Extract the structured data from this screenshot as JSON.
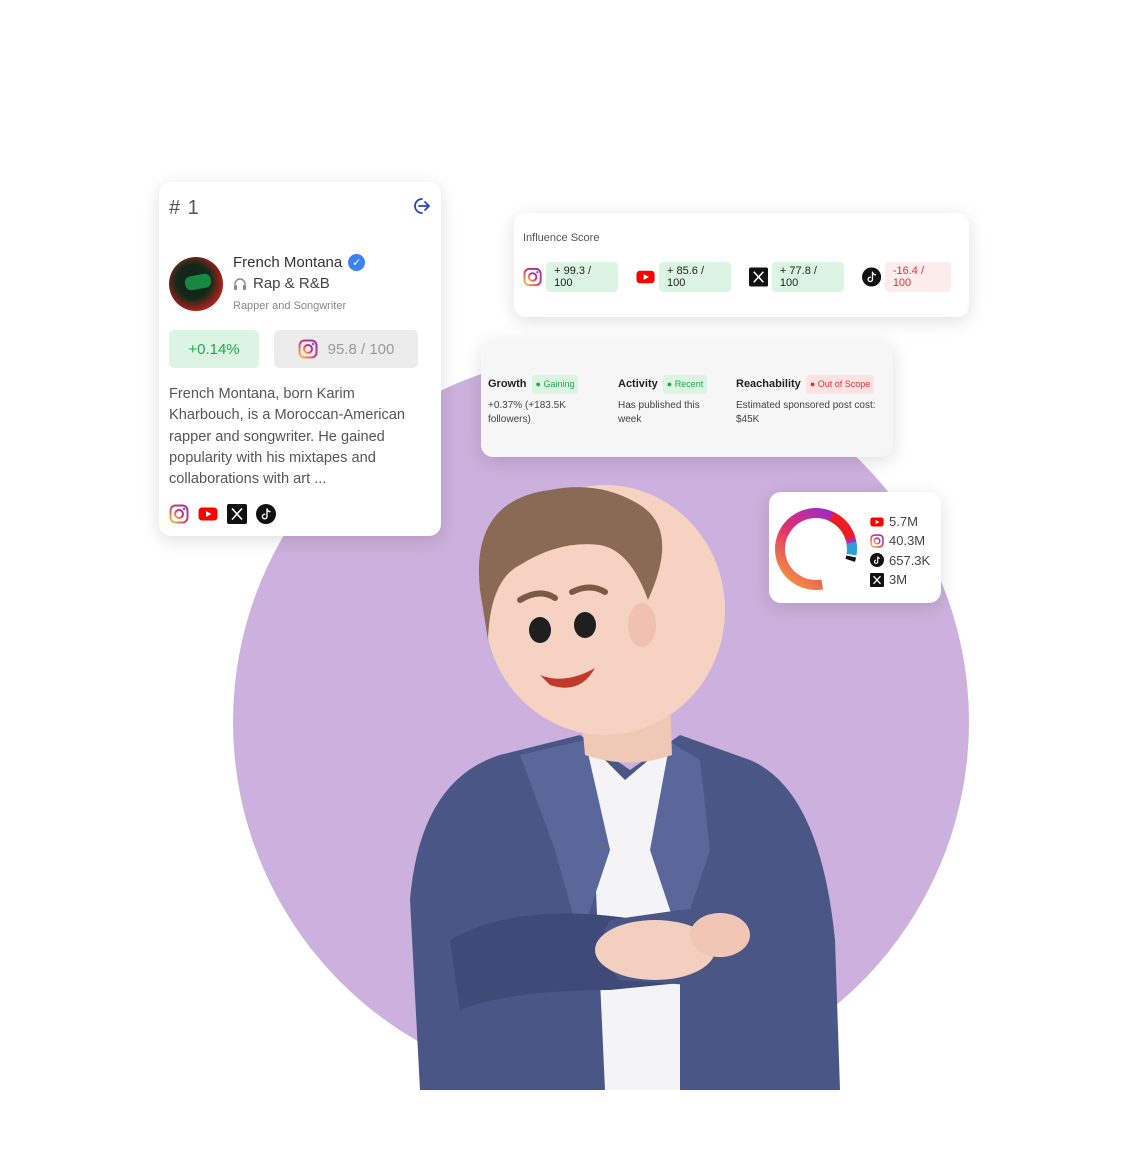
{
  "profile": {
    "rank": "# 1",
    "name": "French Montana",
    "genre": "Rap & R&B",
    "role": "Rapper and Songwriter",
    "growth": "+0.14%",
    "instagram_score": "95.8 / 100",
    "bio": "French Montana, born Karim Kharbouch, is a Moroccan-American rapper and songwriter. He gained popularity with his mixtapes and collaborations with art ...",
    "social_icons": [
      "instagram-icon",
      "youtube-icon",
      "x-icon",
      "tiktok-icon"
    ]
  },
  "influence": {
    "title": "Influence Score",
    "scores": [
      {
        "platform": "instagram",
        "value": "+ 99.3 / 100"
      },
      {
        "platform": "youtube",
        "value": "+ 85.6 / 100"
      },
      {
        "platform": "x",
        "value": "+ 77.8 / 100"
      },
      {
        "platform": "tiktok",
        "value": "-16.4 / 100"
      }
    ]
  },
  "metrics": {
    "growth": {
      "title": "Growth",
      "tag": "Gaining",
      "text": "+0.37% (+183.5K followers)"
    },
    "activity": {
      "title": "Activity",
      "tag": "Recent",
      "text": "Has published this week"
    },
    "reachability": {
      "title": "Reachability",
      "tag": "Out of Scope",
      "text": "Estimated sponsored post cost: $45K"
    }
  },
  "followers": {
    "youtube": "5.7M",
    "instagram": "40.3M",
    "tiktok": "657.3K",
    "x": "3M"
  },
  "colors": {
    "accent_purple": "#ccb0dd",
    "positive_bg": "#dcf5e3",
    "positive_text": "#22a652",
    "negative_bg": "#fdecec",
    "negative_text": "#dd3333",
    "youtube_red": "#ff0000",
    "verified_blue": "#3b82f6",
    "logout_blue": "#2442c9"
  }
}
